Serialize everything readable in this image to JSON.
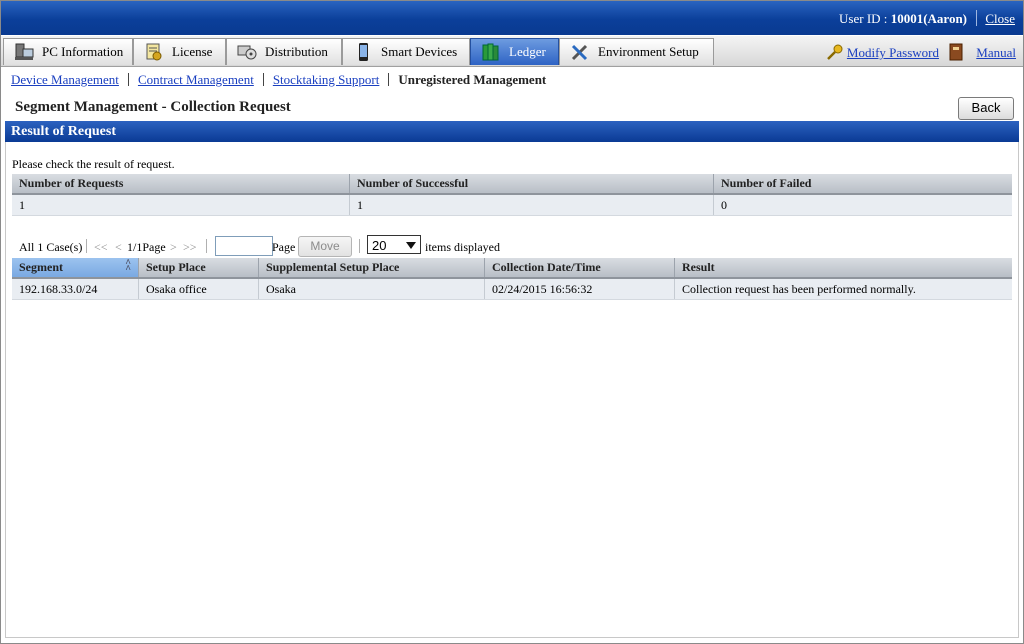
{
  "header": {
    "user_label": "User ID : ",
    "user_value": "10001(Aaron)",
    "close_label": "Close"
  },
  "tabs": [
    {
      "label": "PC Information",
      "icon": "pc-icon"
    },
    {
      "label": "License",
      "icon": "license-icon"
    },
    {
      "label": "Distribution",
      "icon": "distribution-icon"
    },
    {
      "label": "Smart Devices",
      "icon": "smartphone-icon"
    },
    {
      "label": "Ledger",
      "icon": "ledger-icon",
      "active": true
    },
    {
      "label": "Environment Setup",
      "icon": "tools-icon"
    }
  ],
  "top_links": {
    "modify_password": "Modify Password",
    "manual": "Manual"
  },
  "subnav": {
    "device": "Device Management",
    "contract": "Contract Management",
    "stocktaking": "Stocktaking Support",
    "unregistered": "Unregistered Management"
  },
  "page_title": "Segment Management - Collection Request",
  "back_label": "Back",
  "section_title": "Result of Request",
  "message": "Please check the result of request.",
  "summary": {
    "headers": [
      "Number of Requests",
      "Number of Successful",
      "Number of Failed"
    ],
    "row": [
      "1",
      "1",
      "0"
    ]
  },
  "pager": {
    "count": "All 1 Case(s)",
    "first": "<<",
    "prev": "<",
    "page_info": "1/1Page",
    "next": ">",
    "last": ">>",
    "page_label": "Page",
    "move_label": "Move",
    "per_page": "20",
    "items_label": "items displayed"
  },
  "results": {
    "headers": [
      "Segment",
      "Setup Place",
      "Supplemental Setup Place",
      "Collection Date/Time",
      "Result"
    ],
    "rows": [
      [
        "192.168.33.0/24",
        "Osaka office",
        "Osaka",
        "02/24/2015 16:56:32",
        "Collection request has been performed normally."
      ]
    ]
  },
  "colors": {
    "header_blue": "#0b3f9a",
    "link_blue": "#1a3fc0",
    "active_tab": "#2e63c4",
    "sorted_header": "#9cc3ef"
  }
}
